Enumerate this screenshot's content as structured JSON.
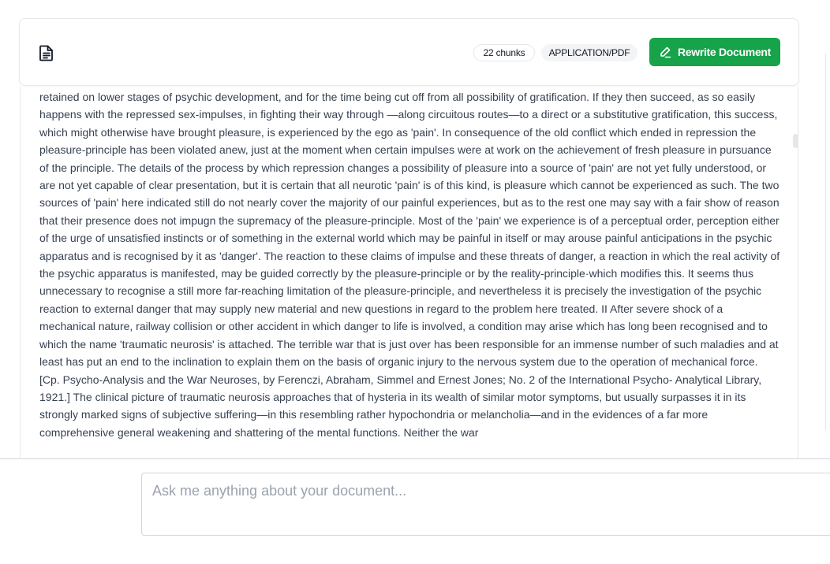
{
  "header": {
    "document_icon": "document-icon",
    "chunks_label": "22 chunks",
    "file_type_label": "APPLICATION/PDF",
    "rewrite_button_label": "Rewrite Document",
    "rewrite_icon": "pencil-icon",
    "accent_color": "#16a34a"
  },
  "document": {
    "text": "retained on lower stages of psychic development, and for the time being cut off from all possibility of gratification. If they then succeed, as so easily happens with the repressed sex-impulses, in fighting their way through —along circuitous routes—to a direct or a substitutive gratification, this success, which might otherwise have brought pleasure, is experienced by the ego as 'pain'. In consequence of the old conflict which ended in repression the pleasure-principle has been violated anew, just at the moment when certain impulses were at work on the achievement of fresh pleasure in pursuance of the principle. The details of the process by which repression changes a possibility of pleasure into a source of 'pain' are not yet fully understood, or are not yet capable of clear presentation, but it is certain that all neurotic 'pain' is of this kind, is pleasure which cannot be experienced as such. The two sources of 'pain' here indicated still do not nearly cover the majority of our painful experiences, but as to the rest one may say with a fair show of reason that their presence does not impugn the supremacy of the pleasure-principle. Most of the 'pain' we experience is of a perceptual order, perception either of the urge of unsatisfied instincts or of something in the external world which may be painful in itself or may arouse painful anticipations in the psychic apparatus and is recognised by it as 'danger'. The reaction to these claims of impulse and these threats of danger, a reaction in which the real activity of the psychic apparatus is manifested, may be guided correctly by the pleasure-principle or by the reality-principle·which modifies this. It seems thus unnecessary to recognise a still more far-reaching limitation of the pleasure-principle, and nevertheless it is precisely the investigation of the psychic reaction to external danger that may supply new material and new questions in regard to the problem here treated. II After severe shock of a mechanical nature, railway collision or other accident in which danger to life is involved, a condition may arise which has long been recognised and to which the name 'traumatic neurosis' is attached. The terrible war that is just over has been responsible for an immense number of such maladies and at least has put an end to the inclination to explain them on the basis of organic injury to the nervous system due to the operation of mechanical force. [Cp. Psycho-Analysis and the War Neuroses, by Ferenczi, Abraham, Simmel and Ernest Jones; No. 2 of the International Psycho- Analytical Library, 1921.] The clinical picture of traumatic neurosis approaches that of hysteria in its wealth of similar motor symptoms, but usually surpasses it in its strongly marked signs of subjective suffering—in this resembling rather hypochondria or melancholia—and in the evidences of a far more comprehensive general weakening and shattering of the mental functions. Neither the war"
  },
  "chat": {
    "placeholder": "Ask me anything about your document..."
  }
}
